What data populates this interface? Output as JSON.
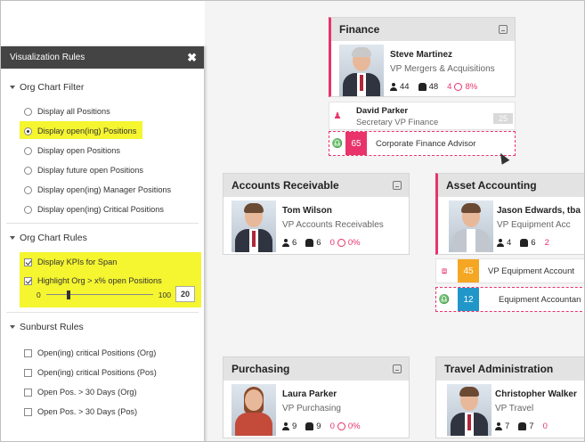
{
  "panel": {
    "title": "Visualization Rules",
    "close": "✖",
    "org_filter": {
      "title": "Org Chart Filter",
      "options": [
        {
          "label": "Display all Positions",
          "selected": false
        },
        {
          "label": "Display open(ing) Positions",
          "selected": true
        },
        {
          "label": "Display open Positions",
          "selected": false
        },
        {
          "label": "Display future open Positions",
          "selected": false
        },
        {
          "label": "Display open(ing) Manager Positions",
          "selected": false
        },
        {
          "label": "Display open(ing) Critical Positions",
          "selected": false
        }
      ]
    },
    "org_rules": {
      "title": "Org Chart Rules",
      "options": [
        {
          "label": "Display KPIs for Span",
          "checked": true
        },
        {
          "label": "Highlight Org > x% open Positions",
          "checked": true
        }
      ],
      "slider": {
        "min": "0",
        "max": "100",
        "value": "20",
        "level": 0.2
      }
    },
    "sunburst": {
      "title": "Sunburst Rules",
      "options": [
        {
          "label": "Open(ing) critical Positions (Org)",
          "checked": false
        },
        {
          "label": "Open(ing) critical Positions (Pos)",
          "checked": false
        },
        {
          "label": "Open Pos. > 30 Days (Org)",
          "checked": false
        },
        {
          "label": "Open Pos. > 30 Days (Pos)",
          "checked": false
        }
      ]
    }
  },
  "cards": {
    "finance": {
      "title": "Finance",
      "name": "Steve Martinez",
      "role": "VP Mergers & Acquisitions",
      "s1": "44",
      "s2": "48",
      "s3": "4",
      "s4": "8%",
      "sub1_name": "David Parker",
      "sub1_role": "Secretary VP Finance",
      "sub1_badge": "25",
      "sub2_num": "65",
      "sub2_label": "Corporate Finance Advisor"
    },
    "accounts": {
      "title": "Accounts Receivable",
      "name": "Tom Wilson",
      "role": "VP Accounts Receivables",
      "s1": "6",
      "s2": "6",
      "s3": "0",
      "s4": "0%"
    },
    "asset": {
      "title": "Asset Accounting",
      "name": "Jason Edwards, tba",
      "role": "VP Equipment Acc",
      "s1": "4",
      "s2": "6",
      "s3": "2",
      "sub1_num": "45",
      "sub1_label": "VP Equipment Account",
      "sub2_num": "12",
      "sub2_label": "Equipment Accountan"
    },
    "purchasing": {
      "title": "Purchasing",
      "name": "Laura Parker",
      "role": "VP Purchasing",
      "s1": "9",
      "s2": "9",
      "s3": "0",
      "s4": "0%"
    },
    "travel": {
      "title": "Travel Administration",
      "name": "Christopher Walker",
      "role": "VP Travel",
      "s1": "7",
      "s2": "7",
      "s3": "0"
    }
  },
  "colors": {
    "accent": "#e8336b",
    "orange": "#f5a623",
    "blue": "#2196c9",
    "highlight": "#f5f530",
    "panel_head": "#444444"
  }
}
